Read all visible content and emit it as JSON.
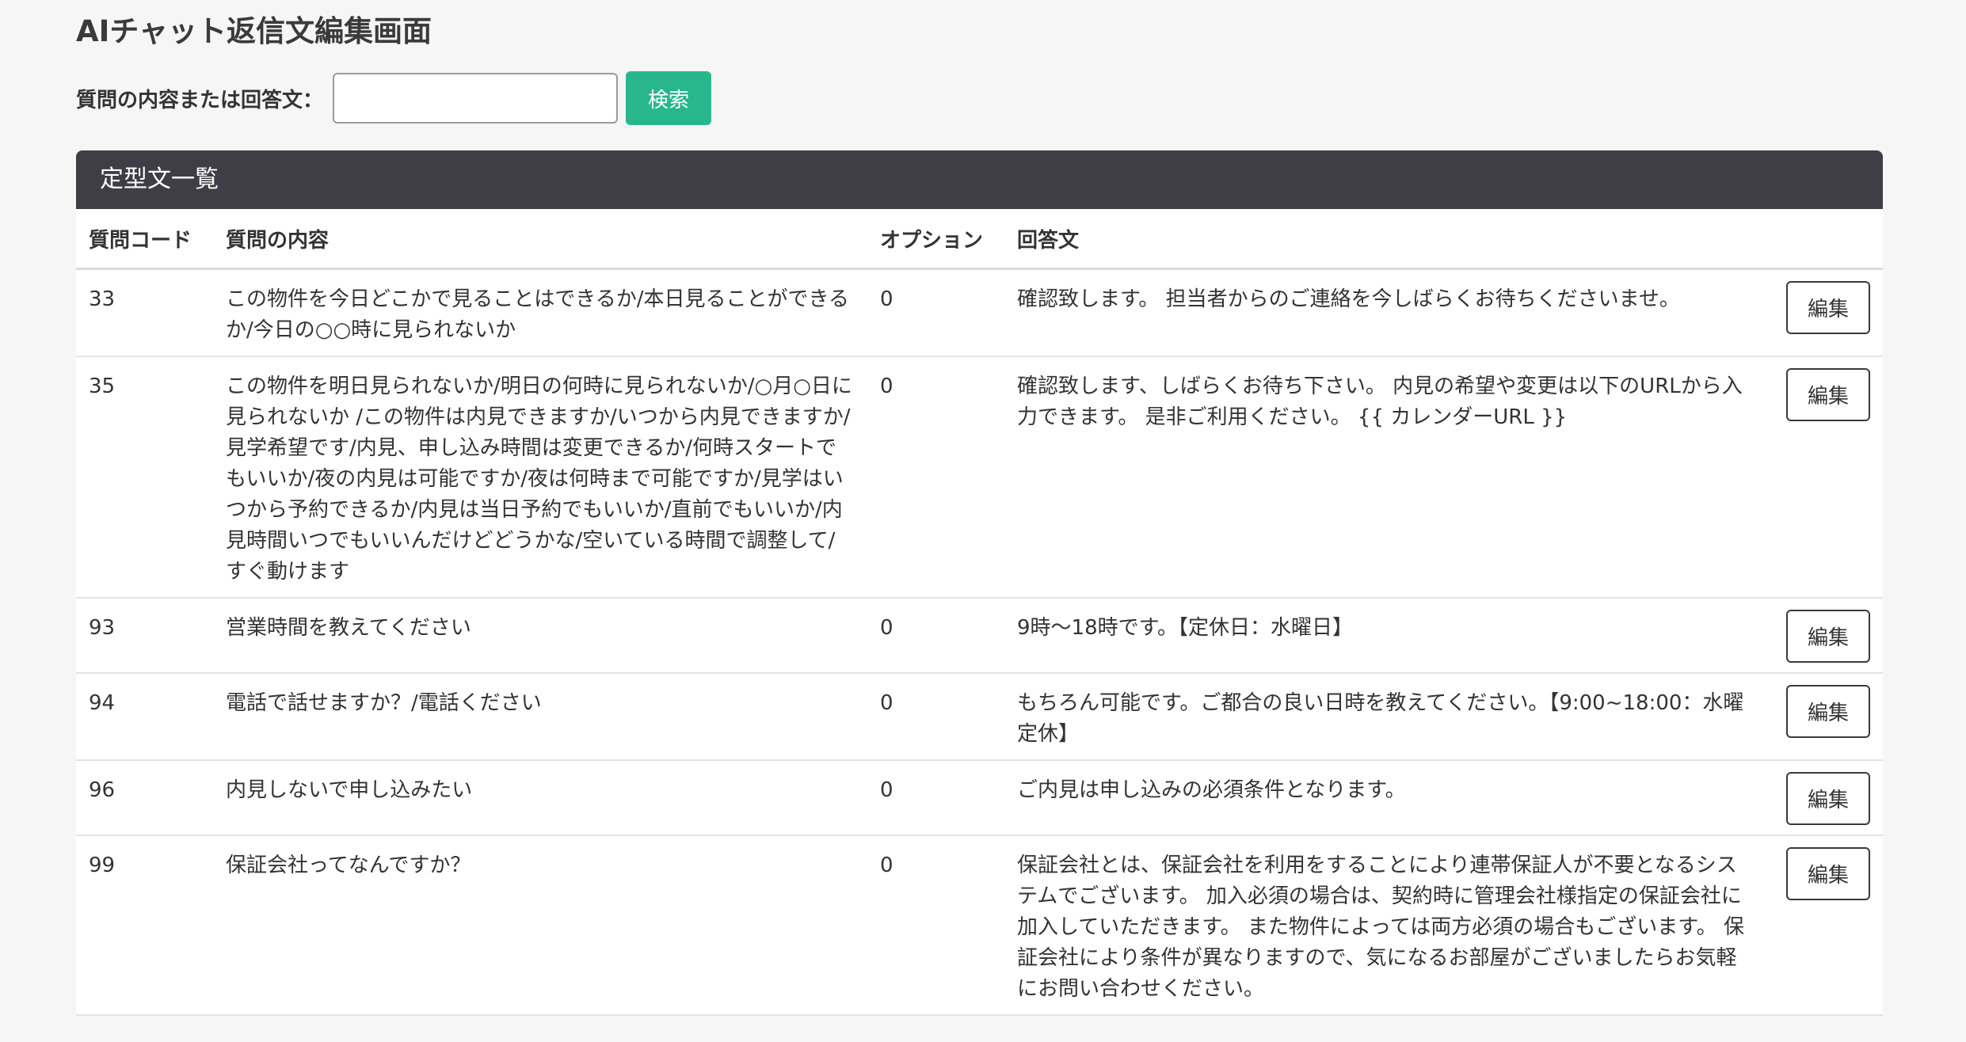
{
  "page": {
    "title": "AIチャット返信文編集画面"
  },
  "search": {
    "label": "質問の内容または回答文：",
    "value": "",
    "placeholder": "",
    "button_label": "検索"
  },
  "panel": {
    "title": "定型文一覧"
  },
  "table": {
    "headers": {
      "code": "質問コード",
      "question": "質問の内容",
      "option": "オプション",
      "answer": "回答文"
    },
    "rows": [
      {
        "code": "33",
        "question": "この物件を今日どこかで見ることはできるか/本日見ることができるか/今日の○○時に見られないか",
        "option": "0",
        "answer": "確認致します。 担当者からのご連絡を今しばらくお待ちくださいませ。",
        "edit_label": "編集"
      },
      {
        "code": "35",
        "question": "この物件を明日見られないか/明日の何時に見られないか/○月○日に見られないか /この物件は内見できますか/いつから内見できますか/見学希望です/内見、申し込み時間は変更できるか/何時スタートでもいいか/夜の内見は可能ですか/夜は何時まで可能ですか/見学はいつから予約できるか/内見は当日予約でもいいか/直前でもいいか/内見時間いつでもいいんだけどどうかな/空いている時間で調整して/すぐ動けます",
        "option": "0",
        "answer": "確認致します、しばらくお待ち下さい。 内見の希望や変更は以下のURLから入力できます。 是非ご利用ください。 {{ カレンダーURL }}",
        "edit_label": "編集"
      },
      {
        "code": "93",
        "question": "営業時間を教えてください",
        "option": "0",
        "answer": "9時〜18時です。【定休日：水曜日】",
        "edit_label": "編集"
      },
      {
        "code": "94",
        "question": "電話で話せますか？/電話ください",
        "option": "0",
        "answer": "もちろん可能です。ご都合の良い日時を教えてください。【9:00~18:00：水曜定休】",
        "edit_label": "編集"
      },
      {
        "code": "96",
        "question": "内見しないで申し込みたい",
        "option": "0",
        "answer": "ご内見は申し込みの必須条件となります。",
        "edit_label": "編集"
      },
      {
        "code": "99",
        "question": "保証会社ってなんですか？",
        "option": "0",
        "answer": "保証会社とは、保証会社を利用をすることにより連帯保証人が不要となるシステムでございます。 加入必須の場合は、契約時に管理会社様指定の保証会社に加入していただきます。 また物件によっては両方必須の場合もございます。 保証会社により条件が異なりますので、気になるお部屋がございましたらお気軽にお問い合わせください。",
        "edit_label": "編集"
      }
    ]
  }
}
